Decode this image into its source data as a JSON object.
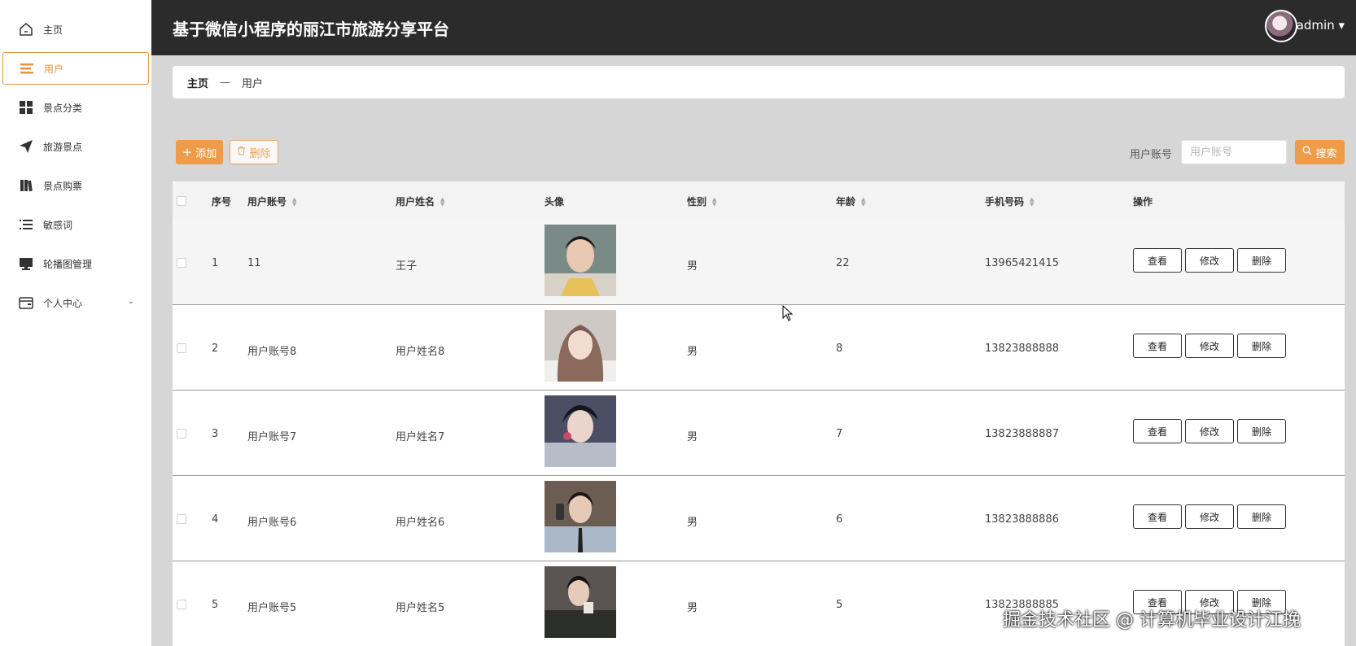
{
  "app": {
    "title": "基于微信小程序的丽江市旅游分享平台",
    "user": "admin ▾"
  },
  "sidebar": {
    "items": [
      {
        "label": "主页",
        "icon": "home-icon"
      },
      {
        "label": "用户",
        "icon": "list-icon"
      },
      {
        "label": "景点分类",
        "icon": "grid-icon"
      },
      {
        "label": "旅游景点",
        "icon": "paper-plane-icon"
      },
      {
        "label": "景点购票",
        "icon": "books-icon"
      },
      {
        "label": "敏感词",
        "icon": "menu-lines-icon"
      },
      {
        "label": "轮播图管理",
        "icon": "monitor-icon"
      },
      {
        "label": "个人中心",
        "icon": "wallet-icon",
        "chevron": "⌄"
      }
    ]
  },
  "breadcrumb": {
    "home": "主页",
    "separator": "—",
    "current": "用户"
  },
  "toolbar": {
    "add_label": "添加",
    "delete_label": "删除",
    "search_label": "用户账号",
    "search_placeholder": "用户账号",
    "search_button": "搜索"
  },
  "table": {
    "columns": {
      "index": "序号",
      "account": "用户账号",
      "name": "用户姓名",
      "avatar": "头像",
      "gender": "性别",
      "age": "年龄",
      "phone": "手机号码",
      "actions": "操作"
    },
    "actions": {
      "view": "查看",
      "edit": "修改",
      "delete": "删除"
    },
    "rows": [
      {
        "index": "1",
        "account": "11",
        "name": "王子",
        "gender": "男",
        "age": "22",
        "phone": "13965421415"
      },
      {
        "index": "2",
        "account": "用户账号8",
        "name": "用户姓名8",
        "gender": "男",
        "age": "8",
        "phone": "13823888888"
      },
      {
        "index": "3",
        "account": "用户账号7",
        "name": "用户姓名7",
        "gender": "男",
        "age": "7",
        "phone": "13823888887"
      },
      {
        "index": "4",
        "account": "用户账号6",
        "name": "用户姓名6",
        "gender": "男",
        "age": "6",
        "phone": "13823888886"
      },
      {
        "index": "5",
        "account": "用户账号5",
        "name": "用户姓名5",
        "gender": "男",
        "age": "5",
        "phone": "13823888885"
      }
    ]
  },
  "watermark": "掘金技术社区 @ 计算机毕业设计江挽",
  "colors": {
    "accent": "#ee9c4a",
    "header_bg": "#2b2b2b",
    "content_bg": "#d6d6d6"
  }
}
